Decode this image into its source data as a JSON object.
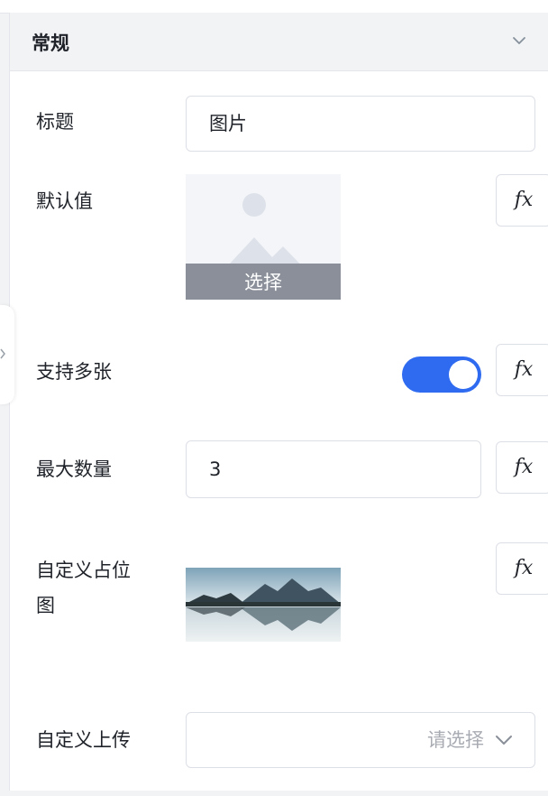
{
  "section": {
    "title": "常规"
  },
  "fields": {
    "title": {
      "label": "标题",
      "value": "图片"
    },
    "default_value": {
      "label": "默认值",
      "choose_label": "选择",
      "fx": "fx"
    },
    "multiple": {
      "label": "支持多张",
      "enabled": true,
      "fx": "fx"
    },
    "max_count": {
      "label": "最大数量",
      "value": "3",
      "fx": "fx"
    },
    "placeholder_image": {
      "label_line1": "自定义占位",
      "label_line2": "图",
      "fx": "fx"
    },
    "custom_upload": {
      "label": "自定义上传",
      "placeholder": "请选择"
    }
  },
  "colors": {
    "accent": "#2e6bf0",
    "border": "#dcdfe6",
    "header_bg": "#f2f3f5"
  },
  "icons": [
    "chevron-down-icon",
    "image-placeholder-icon",
    "chevron-down-icon"
  ]
}
